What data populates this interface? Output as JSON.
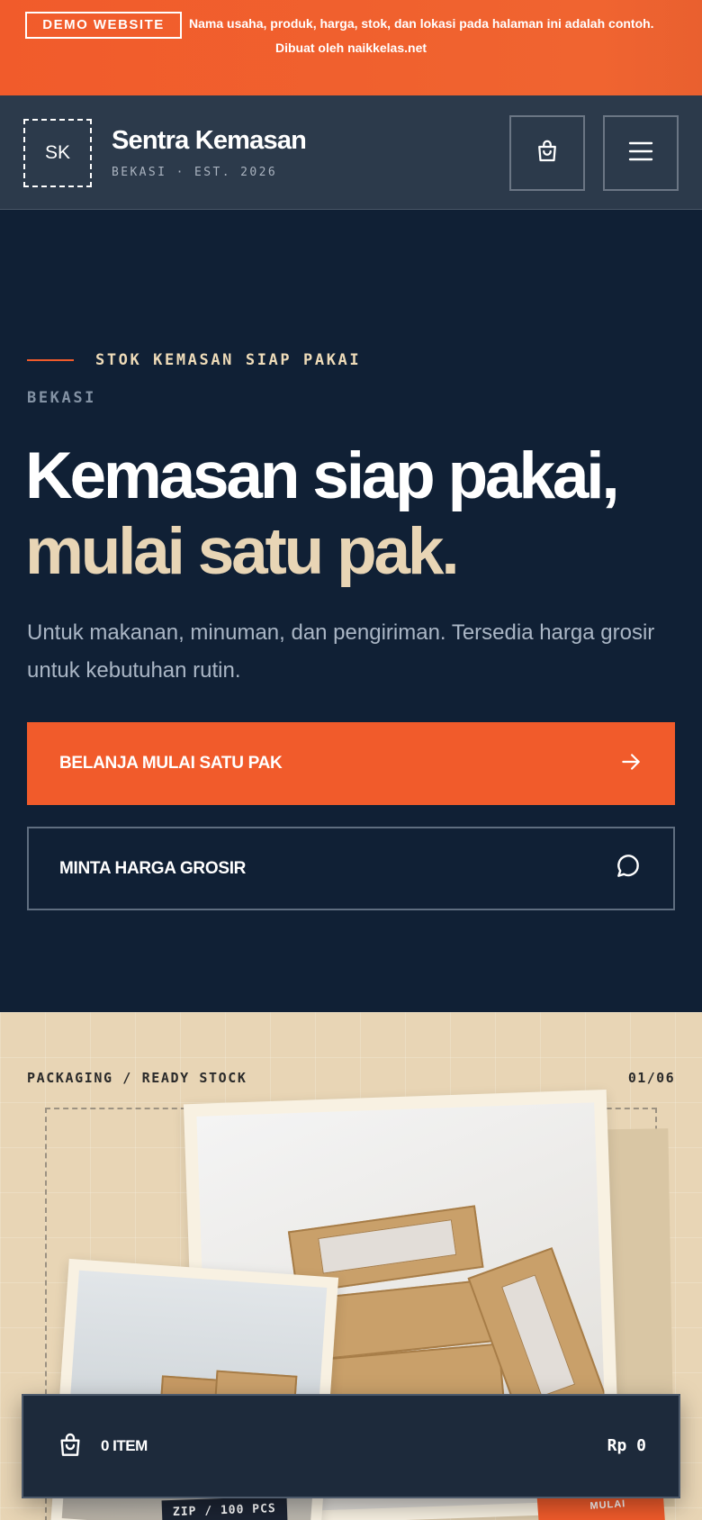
{
  "demo_banner": {
    "badge": "DEMO WEBSITE",
    "text": "Nama usaha, produk, harga, stok, dan lokasi pada halaman ini adalah contoh.",
    "credit": "Dibuat oleh naikkelas.net"
  },
  "header": {
    "logo_initials": "SK",
    "brand_name": "Sentra Kemasan",
    "brand_sub": "BEKASI · EST. 2026",
    "cart_icon": "shopping-bag-icon",
    "menu_icon": "hamburger-menu-icon"
  },
  "hero": {
    "eyebrow": "STOK KEMASAN SIAP PAKAI",
    "location": "BEKASI",
    "title_line1": "Kemasan siap pakai,",
    "title_line2": "mulai satu pak.",
    "description": "Untuk makanan, minuman, dan pengiriman. Tersedia harga grosir untuk kebutuhan rutin.",
    "primary_button": "BELANJA MULAI SATU PAK",
    "primary_icon": "arrow-right-icon",
    "secondary_button": "MINTA HARGA GROSIR",
    "secondary_icon": "chat-bubble-icon"
  },
  "showcase": {
    "category": "PACKAGING / READY STOCK",
    "counter": "01/06",
    "tag_label": "ZIP / 100 PCS",
    "orange_tag": "MULAI"
  },
  "cart_bar": {
    "item_count": "0 ITEM",
    "total": "Rp 0",
    "icon": "shopping-bag-icon"
  },
  "colors": {
    "accent": "#f15b2b",
    "navy": "#102035",
    "cream": "#e8d5b5",
    "header_bg": "#2c3a4b"
  }
}
